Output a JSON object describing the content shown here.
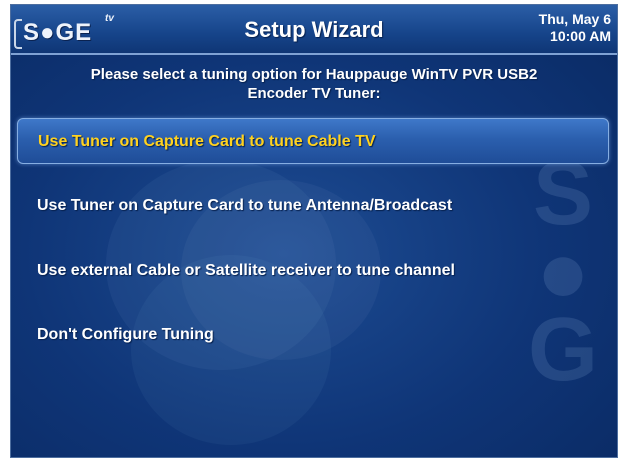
{
  "header": {
    "logo_text": "S●GE",
    "logo_tv": "tv",
    "title": "Setup Wizard",
    "date": "Thu, May 6",
    "time": "10:00 AM"
  },
  "prompt": {
    "line1": "Please select a tuning option for Hauppauge WinTV PVR USB2",
    "line2": "Encoder TV Tuner:"
  },
  "options": [
    {
      "label": "Use Tuner on Capture Card to tune Cable TV",
      "selected": true
    },
    {
      "label": "Use Tuner on Capture Card to tune Antenna/Broadcast",
      "selected": false
    },
    {
      "label": "Use external Cable or Satellite receiver to tune channel",
      "selected": false
    },
    {
      "label": "Don't Configure Tuning",
      "selected": false
    }
  ],
  "colors": {
    "background": "#0f3577",
    "selected_text": "#ffd21f",
    "text": "#ffffff"
  }
}
